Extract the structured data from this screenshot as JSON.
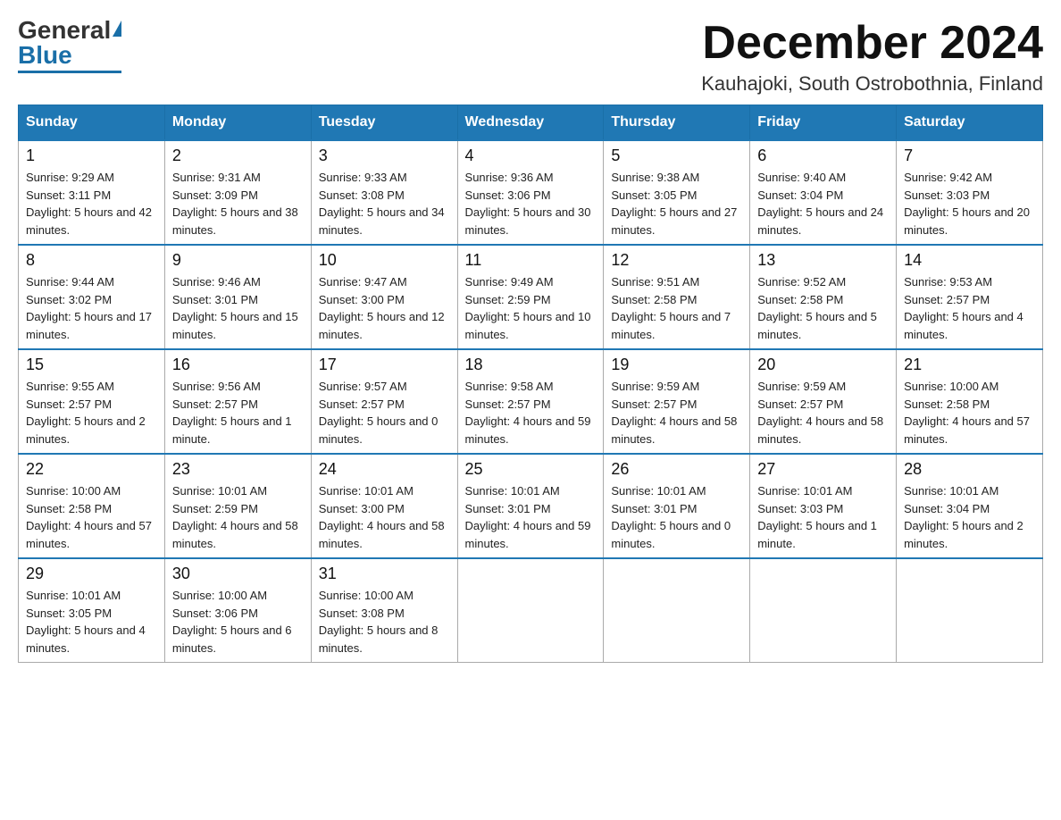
{
  "logo": {
    "general": "General",
    "blue": "Blue"
  },
  "title": "December 2024",
  "location": "Kauhajoki, South Ostrobothnia, Finland",
  "weekdays": [
    "Sunday",
    "Monday",
    "Tuesday",
    "Wednesday",
    "Thursday",
    "Friday",
    "Saturday"
  ],
  "weeks": [
    [
      {
        "day": "1",
        "sunrise": "9:29 AM",
        "sunset": "3:11 PM",
        "daylight": "5 hours and 42 minutes."
      },
      {
        "day": "2",
        "sunrise": "9:31 AM",
        "sunset": "3:09 PM",
        "daylight": "5 hours and 38 minutes."
      },
      {
        "day": "3",
        "sunrise": "9:33 AM",
        "sunset": "3:08 PM",
        "daylight": "5 hours and 34 minutes."
      },
      {
        "day": "4",
        "sunrise": "9:36 AM",
        "sunset": "3:06 PM",
        "daylight": "5 hours and 30 minutes."
      },
      {
        "day": "5",
        "sunrise": "9:38 AM",
        "sunset": "3:05 PM",
        "daylight": "5 hours and 27 minutes."
      },
      {
        "day": "6",
        "sunrise": "9:40 AM",
        "sunset": "3:04 PM",
        "daylight": "5 hours and 24 minutes."
      },
      {
        "day": "7",
        "sunrise": "9:42 AM",
        "sunset": "3:03 PM",
        "daylight": "5 hours and 20 minutes."
      }
    ],
    [
      {
        "day": "8",
        "sunrise": "9:44 AM",
        "sunset": "3:02 PM",
        "daylight": "5 hours and 17 minutes."
      },
      {
        "day": "9",
        "sunrise": "9:46 AM",
        "sunset": "3:01 PM",
        "daylight": "5 hours and 15 minutes."
      },
      {
        "day": "10",
        "sunrise": "9:47 AM",
        "sunset": "3:00 PM",
        "daylight": "5 hours and 12 minutes."
      },
      {
        "day": "11",
        "sunrise": "9:49 AM",
        "sunset": "2:59 PM",
        "daylight": "5 hours and 10 minutes."
      },
      {
        "day": "12",
        "sunrise": "9:51 AM",
        "sunset": "2:58 PM",
        "daylight": "5 hours and 7 minutes."
      },
      {
        "day": "13",
        "sunrise": "9:52 AM",
        "sunset": "2:58 PM",
        "daylight": "5 hours and 5 minutes."
      },
      {
        "day": "14",
        "sunrise": "9:53 AM",
        "sunset": "2:57 PM",
        "daylight": "5 hours and 4 minutes."
      }
    ],
    [
      {
        "day": "15",
        "sunrise": "9:55 AM",
        "sunset": "2:57 PM",
        "daylight": "5 hours and 2 minutes."
      },
      {
        "day": "16",
        "sunrise": "9:56 AM",
        "sunset": "2:57 PM",
        "daylight": "5 hours and 1 minute."
      },
      {
        "day": "17",
        "sunrise": "9:57 AM",
        "sunset": "2:57 PM",
        "daylight": "5 hours and 0 minutes."
      },
      {
        "day": "18",
        "sunrise": "9:58 AM",
        "sunset": "2:57 PM",
        "daylight": "4 hours and 59 minutes."
      },
      {
        "day": "19",
        "sunrise": "9:59 AM",
        "sunset": "2:57 PM",
        "daylight": "4 hours and 58 minutes."
      },
      {
        "day": "20",
        "sunrise": "9:59 AM",
        "sunset": "2:57 PM",
        "daylight": "4 hours and 58 minutes."
      },
      {
        "day": "21",
        "sunrise": "10:00 AM",
        "sunset": "2:58 PM",
        "daylight": "4 hours and 57 minutes."
      }
    ],
    [
      {
        "day": "22",
        "sunrise": "10:00 AM",
        "sunset": "2:58 PM",
        "daylight": "4 hours and 57 minutes."
      },
      {
        "day": "23",
        "sunrise": "10:01 AM",
        "sunset": "2:59 PM",
        "daylight": "4 hours and 58 minutes."
      },
      {
        "day": "24",
        "sunrise": "10:01 AM",
        "sunset": "3:00 PM",
        "daylight": "4 hours and 58 minutes."
      },
      {
        "day": "25",
        "sunrise": "10:01 AM",
        "sunset": "3:01 PM",
        "daylight": "4 hours and 59 minutes."
      },
      {
        "day": "26",
        "sunrise": "10:01 AM",
        "sunset": "3:01 PM",
        "daylight": "5 hours and 0 minutes."
      },
      {
        "day": "27",
        "sunrise": "10:01 AM",
        "sunset": "3:03 PM",
        "daylight": "5 hours and 1 minute."
      },
      {
        "day": "28",
        "sunrise": "10:01 AM",
        "sunset": "3:04 PM",
        "daylight": "5 hours and 2 minutes."
      }
    ],
    [
      {
        "day": "29",
        "sunrise": "10:01 AM",
        "sunset": "3:05 PM",
        "daylight": "5 hours and 4 minutes."
      },
      {
        "day": "30",
        "sunrise": "10:00 AM",
        "sunset": "3:06 PM",
        "daylight": "5 hours and 6 minutes."
      },
      {
        "day": "31",
        "sunrise": "10:00 AM",
        "sunset": "3:08 PM",
        "daylight": "5 hours and 8 minutes."
      },
      null,
      null,
      null,
      null
    ]
  ]
}
